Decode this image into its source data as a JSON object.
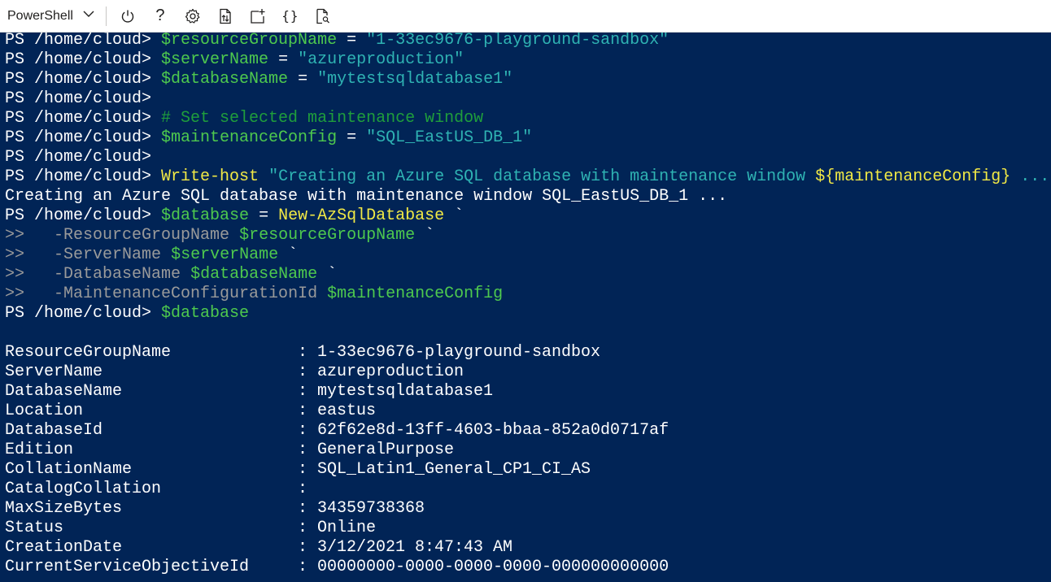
{
  "toolbar": {
    "shell": "PowerShell",
    "help_label": "?",
    "braces_label": "{}"
  },
  "terminal": {
    "prompt": "PS /home/cloud> ",
    "lines": [
      {
        "parts": [
          {
            "t": "PS /home/cloud> ",
            "c": "white"
          },
          {
            "t": "$resourceGroupName",
            "c": "var"
          },
          {
            "t": " = ",
            "c": "white"
          },
          {
            "t": "\"1-33ec9676-playground-sandbox\"",
            "c": "str"
          }
        ]
      },
      {
        "parts": [
          {
            "t": "PS /home/cloud> ",
            "c": "white"
          },
          {
            "t": "$serverName",
            "c": "var"
          },
          {
            "t": " = ",
            "c": "white"
          },
          {
            "t": "\"azureproduction\"",
            "c": "str"
          }
        ]
      },
      {
        "parts": [
          {
            "t": "PS /home/cloud> ",
            "c": "white"
          },
          {
            "t": "$databaseName",
            "c": "var"
          },
          {
            "t": " = ",
            "c": "white"
          },
          {
            "t": "\"mytestsqldatabase1\"",
            "c": "str"
          }
        ]
      },
      {
        "parts": [
          {
            "t": "PS /home/cloud> ",
            "c": "white"
          }
        ]
      },
      {
        "parts": [
          {
            "t": "PS /home/cloud> ",
            "c": "white"
          },
          {
            "t": "# Set selected maintenance window",
            "c": "cmt"
          }
        ]
      },
      {
        "parts": [
          {
            "t": "PS /home/cloud> ",
            "c": "white"
          },
          {
            "t": "$maintenanceConfig",
            "c": "var"
          },
          {
            "t": " = ",
            "c": "white"
          },
          {
            "t": "\"SQL_EastUS_DB_1\"",
            "c": "str"
          }
        ]
      },
      {
        "parts": [
          {
            "t": "PS /home/cloud> ",
            "c": "white"
          }
        ]
      },
      {
        "parts": [
          {
            "t": "PS /home/cloud> ",
            "c": "white"
          },
          {
            "t": "Write-host",
            "c": "cmd"
          },
          {
            "t": " ",
            "c": "white"
          },
          {
            "t": "\"Creating an Azure SQL database with maintenance window ",
            "c": "str"
          },
          {
            "t": "${maintenanceConfig}",
            "c": "cmd"
          },
          {
            "t": " ...",
            "c": "str"
          }
        ]
      },
      {
        "parts": [
          {
            "t": "Creating an Azure SQL database with maintenance window SQL_EastUS_DB_1 ...",
            "c": "white"
          }
        ]
      },
      {
        "parts": [
          {
            "t": "PS /home/cloud> ",
            "c": "white"
          },
          {
            "t": "$database",
            "c": "var"
          },
          {
            "t": " = ",
            "c": "white"
          },
          {
            "t": "New-AzSqlDatabase",
            "c": "cmd"
          },
          {
            "t": " `",
            "c": "white"
          }
        ]
      },
      {
        "parts": [
          {
            "t": ">>   ",
            "c": "cont"
          },
          {
            "t": "-ResourceGroupName",
            "c": "param"
          },
          {
            "t": " ",
            "c": "white"
          },
          {
            "t": "$resourceGroupName",
            "c": "var"
          },
          {
            "t": " `",
            "c": "white"
          }
        ]
      },
      {
        "parts": [
          {
            "t": ">>   ",
            "c": "cont"
          },
          {
            "t": "-ServerName",
            "c": "param"
          },
          {
            "t": " ",
            "c": "white"
          },
          {
            "t": "$serverName",
            "c": "var"
          },
          {
            "t": " `",
            "c": "white"
          }
        ]
      },
      {
        "parts": [
          {
            "t": ">>   ",
            "c": "cont"
          },
          {
            "t": "-DatabaseName",
            "c": "param"
          },
          {
            "t": " ",
            "c": "white"
          },
          {
            "t": "$databaseName",
            "c": "var"
          },
          {
            "t": " `",
            "c": "white"
          }
        ]
      },
      {
        "parts": [
          {
            "t": ">>   ",
            "c": "cont"
          },
          {
            "t": "-MaintenanceConfigurationId",
            "c": "param"
          },
          {
            "t": " ",
            "c": "white"
          },
          {
            "t": "$maintenanceConfig",
            "c": "var"
          }
        ]
      },
      {
        "parts": [
          {
            "t": "PS /home/cloud> ",
            "c": "white"
          },
          {
            "t": "$database",
            "c": "var"
          }
        ]
      }
    ],
    "properties": [
      {
        "name": "ResourceGroupName",
        "sep": ":",
        "value": "1-33ec9676-playground-sandbox"
      },
      {
        "name": "ServerName",
        "sep": ":",
        "value": "azureproduction"
      },
      {
        "name": "DatabaseName",
        "sep": ":",
        "value": "mytestsqldatabase1"
      },
      {
        "name": "Location",
        "sep": ":",
        "value": "eastus"
      },
      {
        "name": "DatabaseId",
        "sep": ":",
        "value": "62f62e8d-13ff-4603-bbaa-852a0d0717af"
      },
      {
        "name": "Edition",
        "sep": ":",
        "value": "GeneralPurpose"
      },
      {
        "name": "CollationName",
        "sep": ":",
        "value": "SQL_Latin1_General_CP1_CI_AS"
      },
      {
        "name": "CatalogCollation",
        "sep": ":",
        "value": ""
      },
      {
        "name": "MaxSizeBytes",
        "sep": ":",
        "value": "34359738368"
      },
      {
        "name": "Status",
        "sep": ":",
        "value": "Online"
      },
      {
        "name": "CreationDate",
        "sep": ":",
        "value": "3/12/2021 8:47:43 AM"
      },
      {
        "name": "CurrentServiceObjectiveId",
        "sep": ":",
        "value": "00000000-0000-0000-0000-000000000000"
      }
    ]
  },
  "colors": {
    "terminal_bg": "#012456",
    "variable": "#4ec94e",
    "string": "#2fb3b3",
    "comment": "#1f9e3c",
    "command": "#f2e945",
    "parameter": "#9a9a9a"
  }
}
